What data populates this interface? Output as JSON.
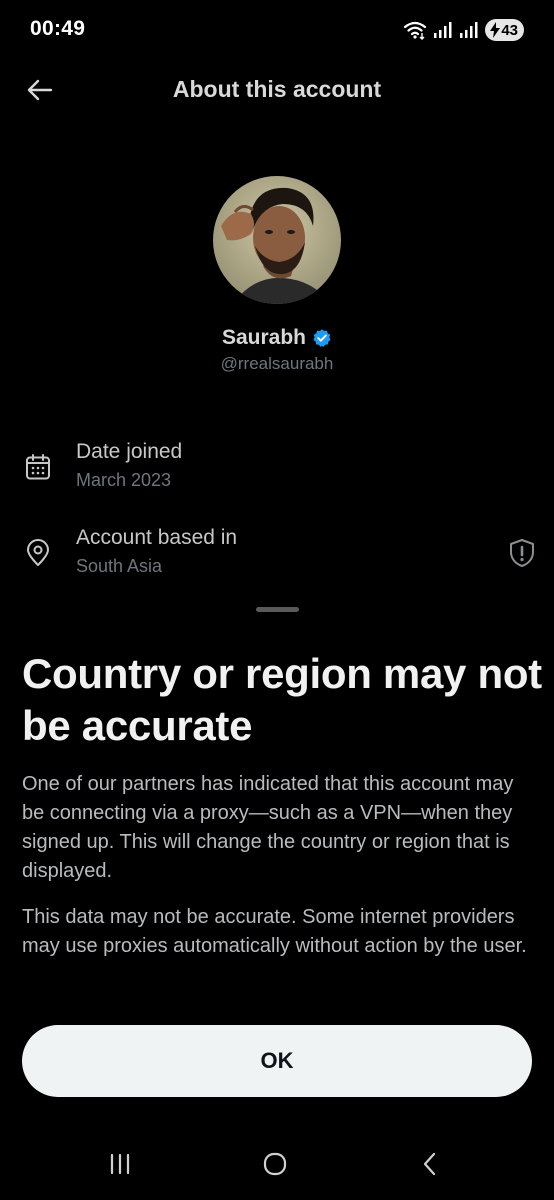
{
  "status_bar": {
    "time": "00:49",
    "battery": "43"
  },
  "header": {
    "title": "About this account"
  },
  "profile": {
    "display_name": "Saurabh",
    "handle": "@rrealsaurabh",
    "verified": true
  },
  "details": [
    {
      "label": "Date joined",
      "value": "March 2023",
      "icon": "calendar-icon"
    },
    {
      "label": "Account based in",
      "value": "South Asia",
      "icon": "location-pin-icon"
    }
  ],
  "sheet": {
    "title": "Country or region may not be accurate",
    "paragraph1": "One of our partners has indicated that this account may be connecting via a proxy—such as a VPN—when they signed up. This will change the country or region that is displayed.",
    "paragraph2": "This data may not be accurate. Some internet providers may use proxies automatically without action by the user.",
    "ok_label": "OK"
  },
  "colors": {
    "background": "#000000",
    "verified_badge": "#1d9bf0",
    "button_bg": "#eff3f4",
    "secondary_text": "#6e767d"
  }
}
